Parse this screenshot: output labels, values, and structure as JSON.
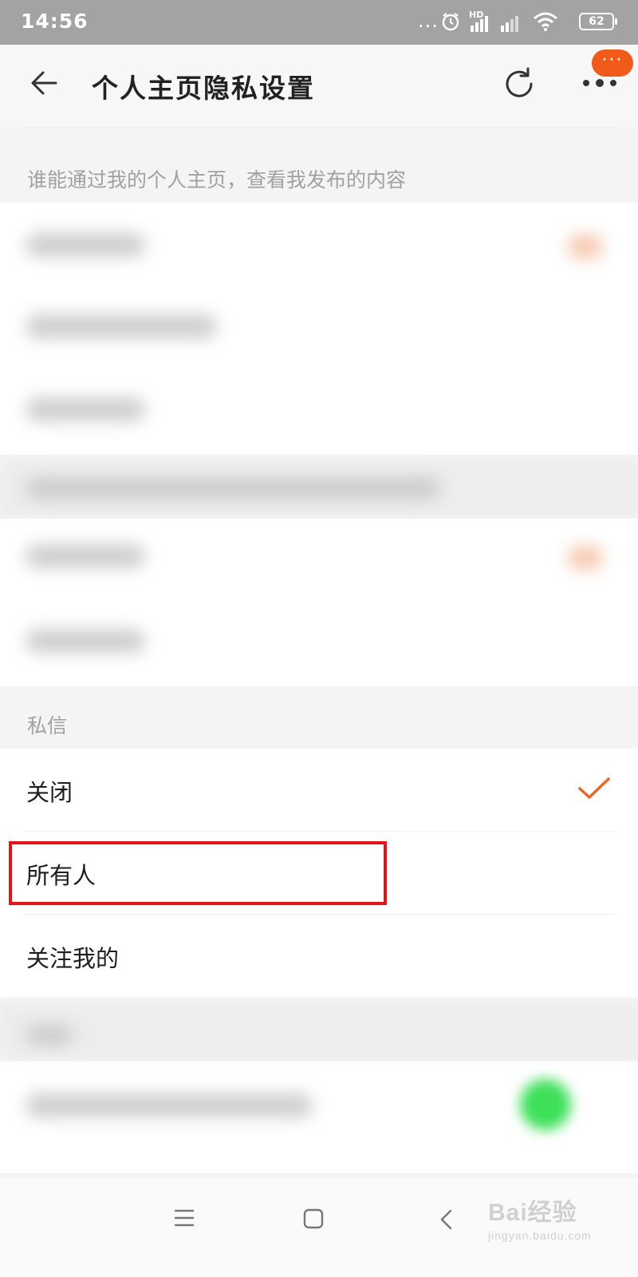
{
  "status_bar": {
    "time": "14:56",
    "more_dots": "...",
    "network_label": "HD",
    "battery": "62"
  },
  "header": {
    "title": "个人主页隐私设置",
    "badge_text": "···",
    "back_icon": "arrow-left-icon",
    "refresh_icon": "refresh-icon",
    "more_icon": "more-dots-icon"
  },
  "sections": {
    "posts_label": "谁能通过我的个人主页，查看我发布的内容",
    "dm_label": "私信"
  },
  "dm_options": [
    {
      "label": "关闭",
      "selected": true
    },
    {
      "label": "所有人",
      "selected": false,
      "highlighted": true
    },
    {
      "label": "关注我的",
      "selected": false
    }
  ],
  "colors": {
    "accent": "#f05a1a",
    "check": "#e9662a",
    "highlight_box": "#e3131a"
  },
  "watermark": {
    "main": "Bai经验",
    "sub": "jingyan.baidu.com"
  },
  "navbar": {
    "menu_icon": "menu-icon",
    "home_icon": "home-square-icon",
    "back_icon": "chevron-left-icon"
  }
}
